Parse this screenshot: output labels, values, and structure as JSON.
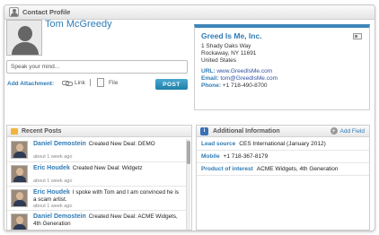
{
  "window": {
    "title": "Contact Profile",
    "icon": "contact-card-icon"
  },
  "contact": {
    "name": "Tom McGreedy",
    "avatar_icon": "person-silhouette-icon"
  },
  "composer": {
    "placeholder": "Speak your mind...",
    "attachment_label": "Add Attachment:",
    "link_label": "Link",
    "file_label": "File",
    "post_button": "POST"
  },
  "company": {
    "name": "Greed Is Me, Inc.",
    "address": [
      "1 Shady Oaks Way",
      "Rockaway, NY 11691",
      "United States"
    ],
    "url_label": "URL:",
    "url": "www.GreedIsMe.com",
    "email_label": "Email:",
    "email": "tom@GreedIsMe.com",
    "phone_label": "Phone:",
    "phone": "+1 718-490-8700"
  },
  "recent_posts": {
    "title": "Recent Posts",
    "items": [
      {
        "author": "Daniel Demostein",
        "text": "Created New Deal: DEMO",
        "time": "about 1 week ago"
      },
      {
        "author": "Eric Houdek",
        "text": "Created New Deal: Widgetz",
        "time": "about 1 week ago"
      },
      {
        "author": "Eric Houdek",
        "text": "I spoke with Tom and I am convinced he is a scam artist.",
        "time": "about 1 week ago"
      },
      {
        "author": "Daniel Demostein",
        "text": "Created New Deal: ACME Widgets, 4th Generation",
        "time": ""
      }
    ]
  },
  "additional_info": {
    "title": "Additional Information",
    "add_field_label": "Add Field",
    "fields": [
      {
        "key": "Lead source",
        "value": "CES International (January 2012)"
      },
      {
        "key": "Mobile",
        "value": "+1 718-367-8179"
      },
      {
        "key": "Product of interest",
        "value": "ACME Widgets, 4th Generation"
      }
    ]
  }
}
